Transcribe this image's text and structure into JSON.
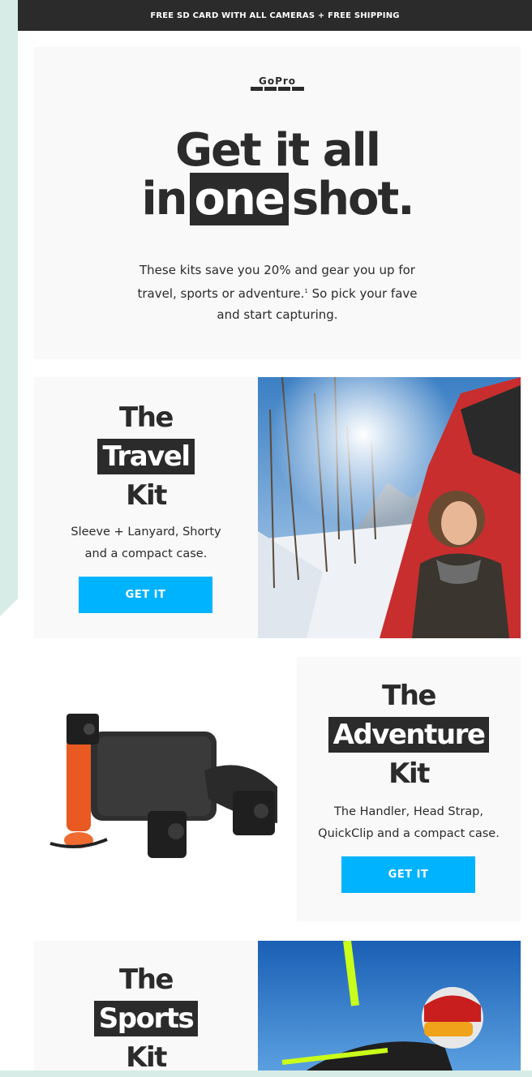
{
  "banner": {
    "text": "FREE SD CARD WITH ALL CAMERAS + FREE SHIPPING"
  },
  "hero": {
    "logo": "GoPro",
    "headline_line1": "Get it all",
    "headline_pre": "in",
    "headline_highlight": "one",
    "headline_post": "shot.",
    "copy_line1": "These kits save you 20% and gear you up for",
    "copy_line2a": "travel, sports or adventure.",
    "copy_footnote": "1",
    "copy_line2b": " So pick your fave",
    "copy_line3": "and start capturing."
  },
  "kits": [
    {
      "the": "The",
      "name": "Travel",
      "kit": "Kit",
      "desc_line1": "Sleeve + Lanyard, Shorty",
      "desc_line2": "and a compact case.",
      "cta": "GET IT"
    },
    {
      "the": "The",
      "name": "Adventure",
      "kit": "Kit",
      "desc_line1": "The Handler, Head Strap,",
      "desc_line2": "QuickClip and a compact case.",
      "cta": "GET IT"
    },
    {
      "the": "The",
      "name": "Sports",
      "kit": "Kit"
    }
  ],
  "colors": {
    "dark": "#2b2b2b",
    "cta": "#00b3ff",
    "panel": "#f9f9f9",
    "page_bg": "#d7ece7"
  }
}
